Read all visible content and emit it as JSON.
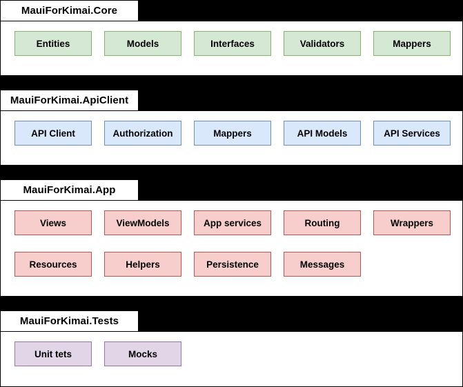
{
  "diagram": {
    "type": "package-diagram",
    "background_color": "#000000",
    "panel_color": "#ffffff",
    "packages": [
      {
        "id": "core",
        "title": "MauiForKimai.Core",
        "fill": "#d5e8d4",
        "stroke": "#82b366",
        "rows": [
          [
            "Entities",
            "Models",
            "Interfaces",
            "Validators",
            "Mappers"
          ]
        ]
      },
      {
        "id": "apiclient",
        "title": "MauiForKimai.ApiClient",
        "fill": "#dae8fc",
        "stroke": "#6c8ebf",
        "rows": [
          [
            "API Client",
            "Authorization",
            "Mappers",
            "API Models",
            "API Services"
          ]
        ]
      },
      {
        "id": "app",
        "title": "MauiForKimai.App",
        "fill": "#f8cecc",
        "stroke": "#b85450",
        "rows": [
          [
            "Views",
            "ViewModels",
            "App services",
            "Routing",
            "Wrappers"
          ],
          [
            "Resources",
            "Helpers",
            "Persistence",
            "Messages"
          ]
        ]
      },
      {
        "id": "tests",
        "title": "MauiForKimai.Tests",
        "fill": "#e1d5e7",
        "stroke": "#9673a6",
        "rows": [
          [
            "Unit tets",
            "Mocks"
          ]
        ]
      }
    ]
  }
}
